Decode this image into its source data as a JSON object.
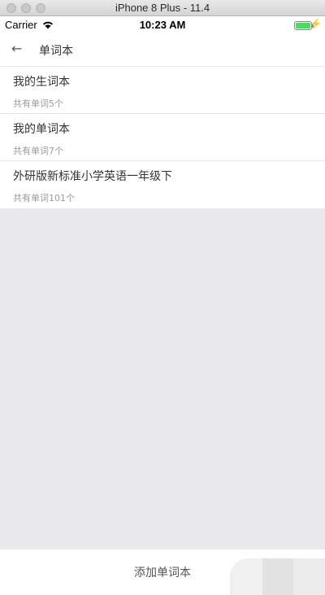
{
  "simulator": {
    "title": "iPhone 8 Plus - 11.4"
  },
  "status_bar": {
    "carrier": "Carrier",
    "time": "10:23 AM"
  },
  "nav": {
    "title": "单词本"
  },
  "wordbooks": [
    {
      "name": "我的生词本",
      "count": "共有单词5个"
    },
    {
      "name": "我的单词本",
      "count": "共有单词7个"
    },
    {
      "name": "外研版新标准小学英语一年级下",
      "count": "共有单词101个"
    }
  ],
  "bottom": {
    "add_label": "添加单词本"
  },
  "colors": {
    "battery": "#4cd964",
    "background": "#e9e8ed"
  }
}
